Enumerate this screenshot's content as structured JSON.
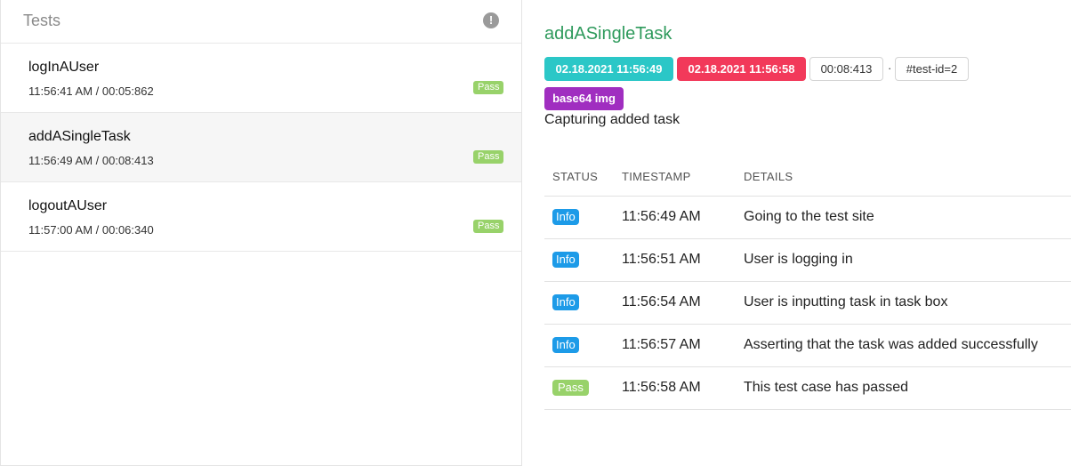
{
  "left_panel": {
    "title": "Tests",
    "alert_glyph": "!",
    "tests": [
      {
        "name": "logInAUser",
        "meta": "11:56:41 AM / 00:05:862",
        "status": "Pass"
      },
      {
        "name": "addASingleTask",
        "meta": "11:56:49 AM / 00:08:413",
        "status": "Pass"
      },
      {
        "name": "logoutAUser",
        "meta": "11:57:00 AM / 00:06:340",
        "status": "Pass"
      }
    ]
  },
  "detail": {
    "title": "addASingleTask",
    "start_time": "02.18.2021 11:56:49",
    "end_time": "02.18.2021 11:56:58",
    "duration": "00:08:413",
    "separator": "·",
    "test_id": "#test-id=2",
    "media_badge": "base64 img",
    "caption": "Capturing added task",
    "table": {
      "headers": [
        "STATUS",
        "TIMESTAMP",
        "DETAILS"
      ],
      "rows": [
        {
          "status": "Info",
          "timestamp": "11:56:49 AM",
          "details": "Going to the test site"
        },
        {
          "status": "Info",
          "timestamp": "11:56:51 AM",
          "details": "User is logging in"
        },
        {
          "status": "Info",
          "timestamp": "11:56:54 AM",
          "details": "User is inputting task in task box"
        },
        {
          "status": "Info",
          "timestamp": "11:56:57 AM",
          "details": "Asserting that the task was added successfully"
        },
        {
          "status": "Pass",
          "timestamp": "11:56:58 AM",
          "details": "This test case has passed"
        }
      ]
    }
  },
  "colors": {
    "pass": "#98d26a",
    "info": "#1d9be8",
    "start_badge": "#2bc7c7",
    "end_badge": "#f2395a",
    "media_badge": "#a02ec0",
    "title_green": "#2e9a5c"
  },
  "icons": {
    "alert": "exclamation-circle-icon"
  }
}
